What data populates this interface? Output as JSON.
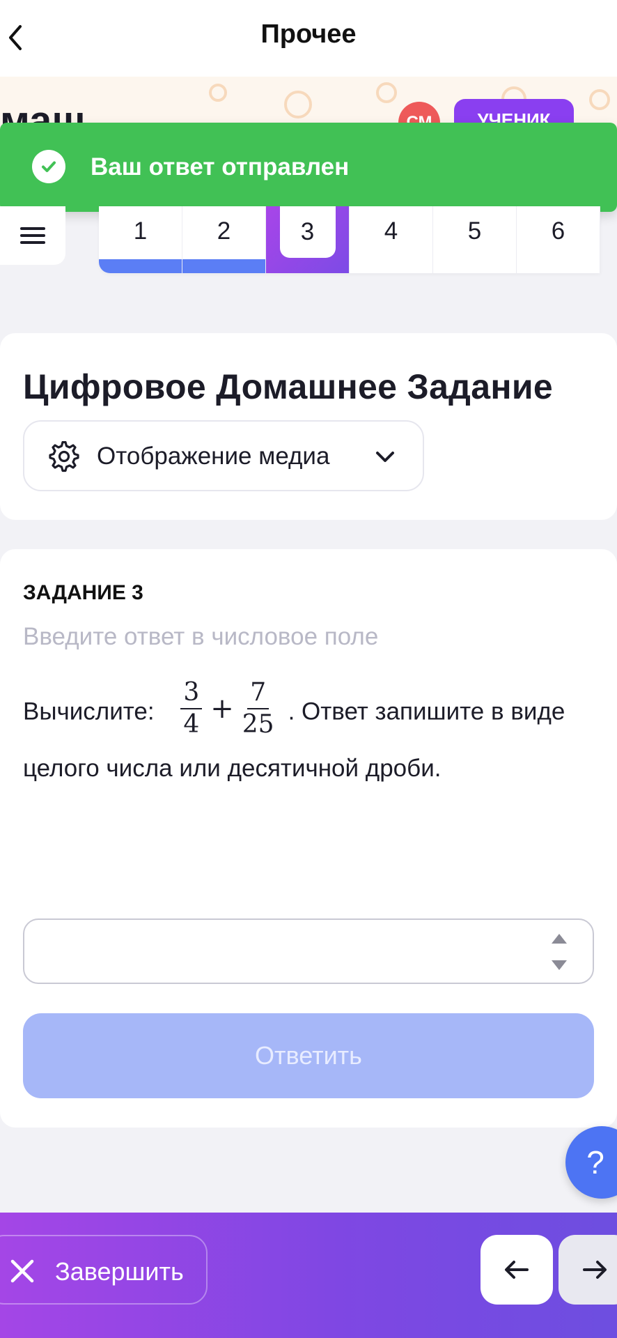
{
  "nav": {
    "title": "Прочее"
  },
  "brand": {
    "logo_text": "маш",
    "avatar_initials": "СМ",
    "role": "УЧЕНИК"
  },
  "toast": {
    "message": "Ваш ответ отправлен",
    "color": "#41c155"
  },
  "task_nav": {
    "tabs": [
      {
        "label": "1",
        "state": "done"
      },
      {
        "label": "2",
        "state": "done"
      },
      {
        "label": "3",
        "state": "active"
      },
      {
        "label": "4",
        "state": "pending"
      },
      {
        "label": "5",
        "state": "pending"
      },
      {
        "label": "6",
        "state": "pending"
      }
    ]
  },
  "header": {
    "title": "Цифровое Домашнее Задание",
    "media_select_label": "Отображение медиа"
  },
  "task": {
    "label": "ЗАДАНИЕ 3",
    "hint": "Введите ответ в числовое поле",
    "question_prefix": "Вычислите:",
    "math": {
      "a_num": "3",
      "a_den": "4",
      "op": "+",
      "b_num": "7",
      "b_den": "25"
    },
    "question_suffix": ". Ответ запишите в виде целого числа или десятичной дроби.",
    "answer_value": "",
    "submit_label": "Ответить"
  },
  "help": {
    "label": "?"
  },
  "footer": {
    "finish_label": "Завершить"
  },
  "colors": {
    "accent": "#5b7ef5",
    "brand_gradient_start": "#a446e6",
    "brand_gradient_end": "#6d4ee0",
    "submit_disabled": "#a6b7f8"
  }
}
